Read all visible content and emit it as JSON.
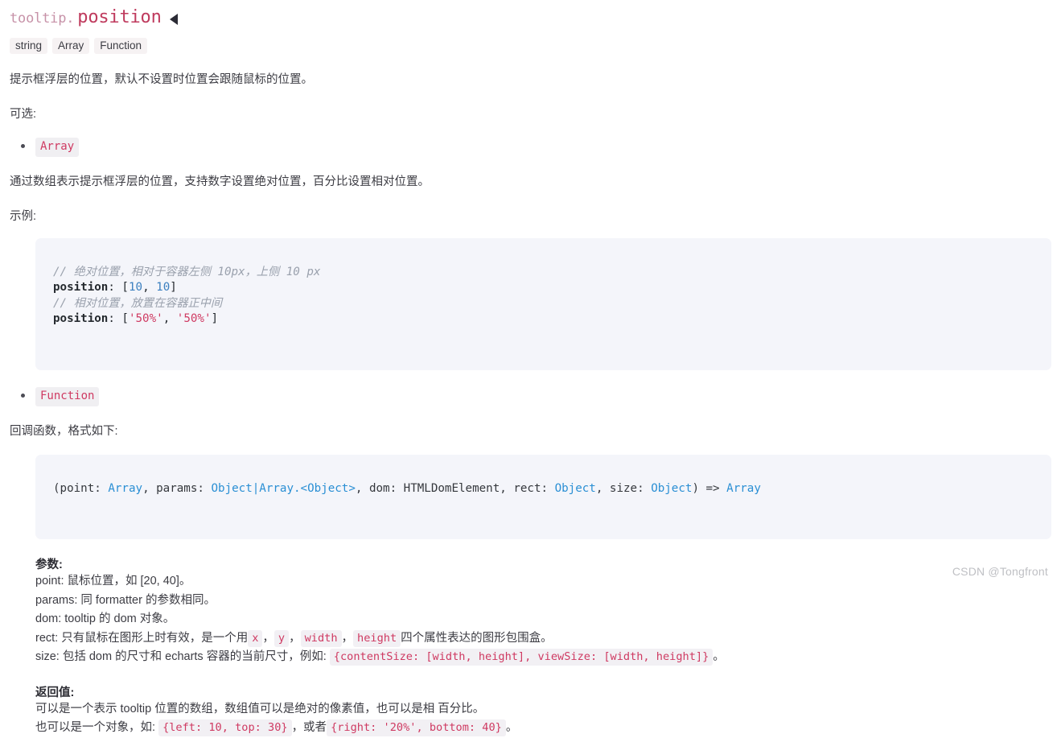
{
  "header": {
    "title_prefix": "tooltip.",
    "title_main": "position",
    "caret_icon": "triangle-left-icon",
    "type_badges": [
      "string",
      "Array",
      "Function"
    ]
  },
  "intro": {
    "description": "提示框浮层的位置，默认不设置时位置会跟随鼠标的位置。",
    "options_label": "可选:"
  },
  "options": [
    {
      "name": "Array",
      "description": "通过数组表示提示框浮层的位置，支持数字设置绝对位置，百分比设置相对位置。",
      "example_label": "示例:",
      "code": {
        "line1_comment": "// 绝对位置，相对于容器左侧 10px，上侧 10 px",
        "line2_key": "position",
        "line2_rest": ": [",
        "line2_num1": "10",
        "line2_sep": ", ",
        "line2_num2": "10",
        "line2_close": "]",
        "line3_comment": "// 相对位置，放置在容器正中间",
        "line4_key": "position",
        "line4_rest": ": [",
        "line4_str1": "'50%'",
        "line4_sep": ", ",
        "line4_str2": "'50%'",
        "line4_close": "]"
      }
    },
    {
      "name": "Function",
      "description": "回调函数，格式如下:",
      "signature": {
        "p0": "(point: ",
        "t1": "Array",
        "p1": ", params: ",
        "t2": "Object",
        "p2": "|",
        "t3": "Array.<Object>",
        "p3": ", dom: HTMLDomElement, rect: ",
        "t4": "Object",
        "p4": ", size: ",
        "t5": "Object",
        "p5": ") => ",
        "t6": "Array"
      }
    }
  ],
  "params": {
    "heading": "参数:",
    "point": "point: 鼠标位置，如 [20, 40]。",
    "params": "params: 同 formatter 的参数相同。",
    "dom": "dom: tooltip 的 dom 对象。",
    "rect_pre": "rect: 只有鼠标在图形上时有效，是一个用",
    "rect_code_x": "x",
    "rect_code_y": "y",
    "rect_code_width": "width",
    "rect_code_height": "height",
    "rect_post": "四个属性表达的图形包围盒。",
    "size_pre": "size: 包括 dom 的尺寸和 echarts 容器的当前尺寸，例如:",
    "size_code": "{contentSize: [width, height], viewSize: [width, height]}",
    "size_post": "。"
  },
  "returns": {
    "heading": "返回值:",
    "line1": "可以是一个表示 tooltip 位置的数组，数组值可以是绝对的像素值，也可以是相 百分比。",
    "line2_pre": "也可以是一个对象，如:",
    "code1": "{left: 10, top: 30}",
    "line2_mid": "，或者",
    "code2": "{right: '20%', bottom: 40}",
    "line2_post": "。"
  },
  "watermark": "CSDN @Tongfront"
}
